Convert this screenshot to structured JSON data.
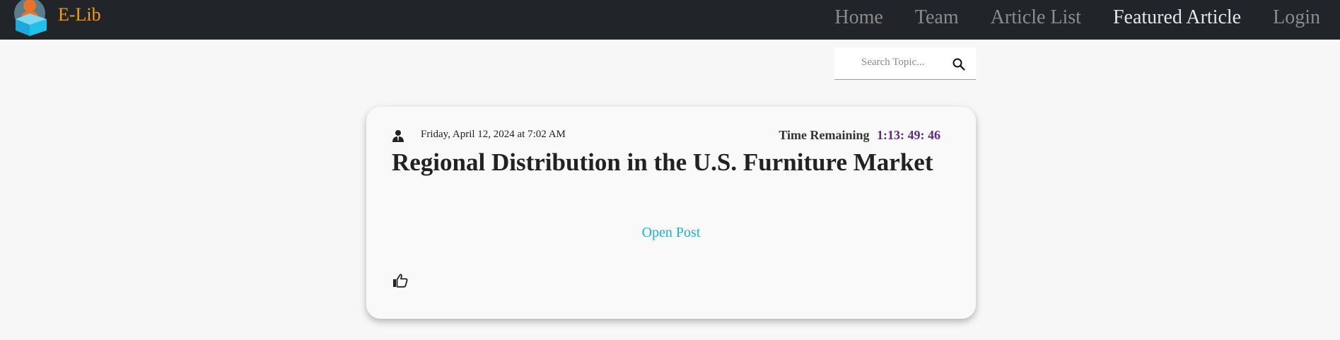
{
  "brand": {
    "name": "E-Lib",
    "logo_icon": "book-reader-logo-icon"
  },
  "nav": {
    "items": [
      {
        "label": "Home",
        "active": false
      },
      {
        "label": "Team",
        "active": false
      },
      {
        "label": "Article List",
        "active": false
      },
      {
        "label": "Featured Article",
        "active": true
      },
      {
        "label": "Login",
        "active": false
      }
    ]
  },
  "search": {
    "placeholder": "Search Topic...",
    "value": "",
    "icon": "search-icon"
  },
  "post": {
    "author_icon": "user-icon",
    "date": "Friday, April 12, 2024 at 7:02 AM",
    "time_remaining_label": "Time Remaining",
    "time_remaining_value": "1:13: 49: 46",
    "title": "Regional Distribution in the U.S. Furniture Market",
    "open_label": "Open Post",
    "like_icon": "thumbs-up-icon"
  },
  "colors": {
    "navbar_bg": "#212529",
    "brand": "#f39c12",
    "nav_link": "#8c8c8c",
    "nav_link_active": "#e6e6e6",
    "page_bg": "#f7f7f7",
    "timer": "#5b2d8e",
    "link": "#1ab3d6"
  }
}
